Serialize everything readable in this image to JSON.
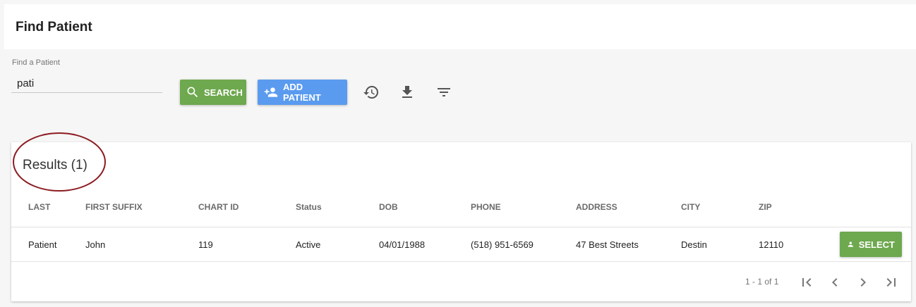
{
  "header": {
    "title": "Find Patient"
  },
  "search": {
    "label": "Find a Patient",
    "value": "pati",
    "search_button": "SEARCH",
    "add_patient_button": "ADD PATIENT"
  },
  "toolbar_icons": [
    "history-icon",
    "download-icon",
    "filter-icon"
  ],
  "results": {
    "title": "Results (1)",
    "columns": [
      "LAST",
      "FIRST SUFFIX",
      "CHART ID",
      "Status",
      "DOB",
      "PHONE",
      "ADDRESS",
      "CITY",
      "ZIP"
    ],
    "rows": [
      {
        "last": "Patient",
        "first": "John",
        "chart_id": "119",
        "status": "Active",
        "dob": "04/01/1988",
        "phone": "(518) 951-6569",
        "address": "47 Best Streets",
        "city": "Destin",
        "zip": "12110",
        "action": "SELECT"
      }
    ],
    "pagination": "1 - 1 of 1"
  },
  "colors": {
    "search_button": "#6ea84f",
    "add_button": "#5a9bef",
    "select_button": "#6ea84f",
    "annotation_ring": "#8c1c22"
  }
}
